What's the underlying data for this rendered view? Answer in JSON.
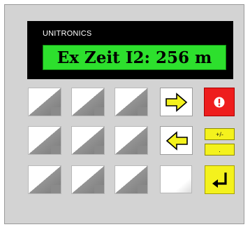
{
  "brand": "UNITRONICS",
  "display": {
    "text": "Ex Zeit I2: 256 m"
  },
  "keys": {
    "right_arrow": "right-arrow-icon",
    "left_arrow": "left-arrow-icon",
    "info": "exclamation-icon",
    "enter": "enter-icon",
    "plus_minus_label": "+/-",
    "dot_label": "."
  },
  "colors": {
    "lcd_background": "#2de02d",
    "info_key": "#ee1d1d",
    "yellow_key": "#f4f21d",
    "panel": "#d3d3d3"
  }
}
